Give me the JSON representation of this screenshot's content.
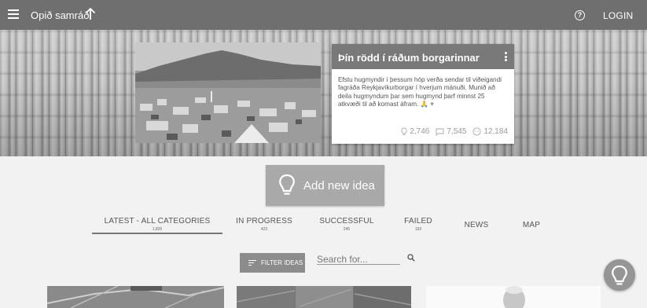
{
  "topbar": {
    "brand": "Opið samráð",
    "login": "LOGIN",
    "icons": {
      "menu": "hamburger-icon",
      "up": "arrow-up-icon",
      "help": "help-circle-icon"
    }
  },
  "hero_card": {
    "title": "Þín rödd í ráðum borgarinnar",
    "body": "Efstu hugmyndir í þessum hóp verða sendar til viðeigandi fagráða Reykjavíkurborgar í hverjum mánuði. Munið að deila hugmyndum þar sem hugmynd þarf minnst 25 atkvæði til að komast áfram.",
    "stats": {
      "ideas": "2,746",
      "comments": "7,545",
      "users": "12,184"
    }
  },
  "add_idea": {
    "label": "Add new idea"
  },
  "tabs": [
    {
      "label": "LATEST - ALL CATEGORIES",
      "count": "1,835"
    },
    {
      "label": "IN PROGRESS",
      "count": "423"
    },
    {
      "label": "SUCCESSFUL",
      "count": "245"
    },
    {
      "label": "FAILED",
      "count": "193"
    },
    {
      "label": "NEWS",
      "count": ""
    },
    {
      "label": "MAP",
      "count": ""
    }
  ],
  "filter": {
    "label": "FILTER IDEAS"
  },
  "search": {
    "placeholder": "Search for..."
  },
  "colors": {
    "topbar": "#6f6f6f",
    "card_header": "#797979",
    "add_button": "#a9a9a9",
    "filter_button": "#8c8c8c"
  }
}
